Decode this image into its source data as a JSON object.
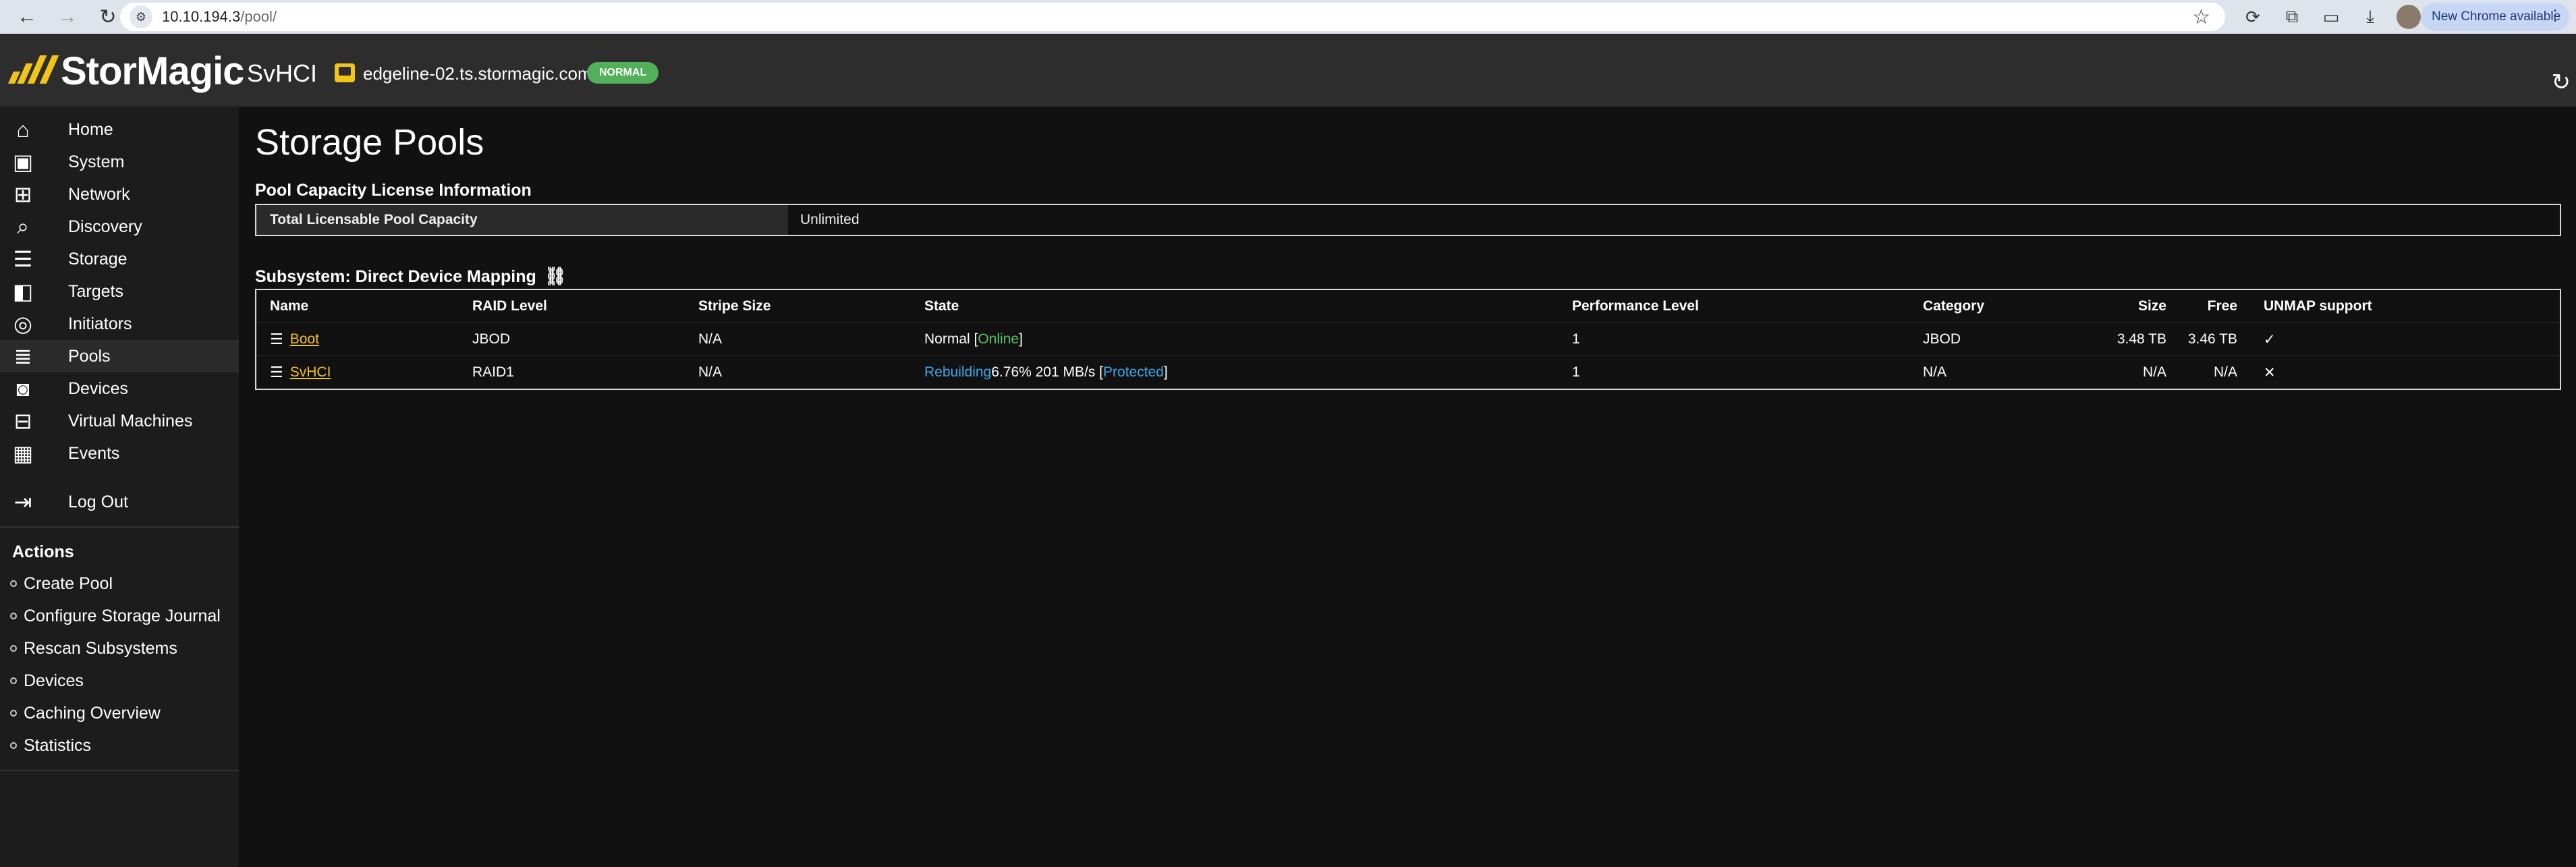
{
  "browser": {
    "url_host": "10.10.194.3",
    "url_path": "/pool/",
    "update_label": "New Chrome available"
  },
  "header": {
    "brand": "StorMagic",
    "product": "SvHCI",
    "hostname": "edgeline-02.ts.stormagic.com",
    "status_badge": "NORMAL",
    "brand_color": "#f2c318",
    "badge_color": "#52b05a"
  },
  "sidebar": {
    "nav": [
      {
        "label": "Home",
        "icon": "home-icon"
      },
      {
        "label": "System",
        "icon": "system-icon"
      },
      {
        "label": "Network",
        "icon": "network-icon"
      },
      {
        "label": "Discovery",
        "icon": "discovery-icon"
      },
      {
        "label": "Storage",
        "icon": "storage-icon"
      },
      {
        "label": "Targets",
        "icon": "targets-icon"
      },
      {
        "label": "Initiators",
        "icon": "initiators-icon"
      },
      {
        "label": "Pools",
        "icon": "pools-icon",
        "active": true
      },
      {
        "label": "Devices",
        "icon": "devices-icon"
      },
      {
        "label": "Virtual Machines",
        "icon": "virtual-machines-icon"
      },
      {
        "label": "Events",
        "icon": "events-icon"
      }
    ],
    "logout": "Log Out",
    "actions_title": "Actions",
    "actions": [
      "Create Pool",
      "Configure Storage Journal",
      "Rescan Subsystems",
      "Devices",
      "Caching Overview",
      "Statistics"
    ]
  },
  "main": {
    "title": "Storage Pools",
    "license_section": "Pool Capacity License Information",
    "license_key": "Total Licensable Pool Capacity",
    "license_value": "Unlimited",
    "subsystem_section": "Subsystem: Direct Device Mapping",
    "columns": [
      "Name",
      "RAID Level",
      "Stripe Size",
      "State",
      "Performance Level",
      "Category",
      "Size",
      "Free",
      "UNMAP support"
    ],
    "pools": [
      {
        "name": "Boot",
        "raid": "JBOD",
        "stripe": "N/A",
        "state_prefix": "Normal [",
        "state_status": "Online",
        "state_status_color": "green",
        "state_suffix": "]",
        "state_progress": "",
        "perf": "1",
        "category": "JBOD",
        "size": "3.48 TB",
        "free": "3.46 TB",
        "unmap": "✓"
      },
      {
        "name": "SvHCI",
        "raid": "RAID1",
        "stripe": "N/A",
        "state_prefix": "",
        "state_status": "Rebuilding",
        "state_status_color": "blue",
        "state_progress": " 6.76% 201 MB/s [",
        "state_flag": "Protected",
        "state_suffix": "]",
        "perf": "1",
        "category": "N/A",
        "size": "N/A",
        "free": "N/A",
        "unmap": "✕"
      }
    ]
  }
}
